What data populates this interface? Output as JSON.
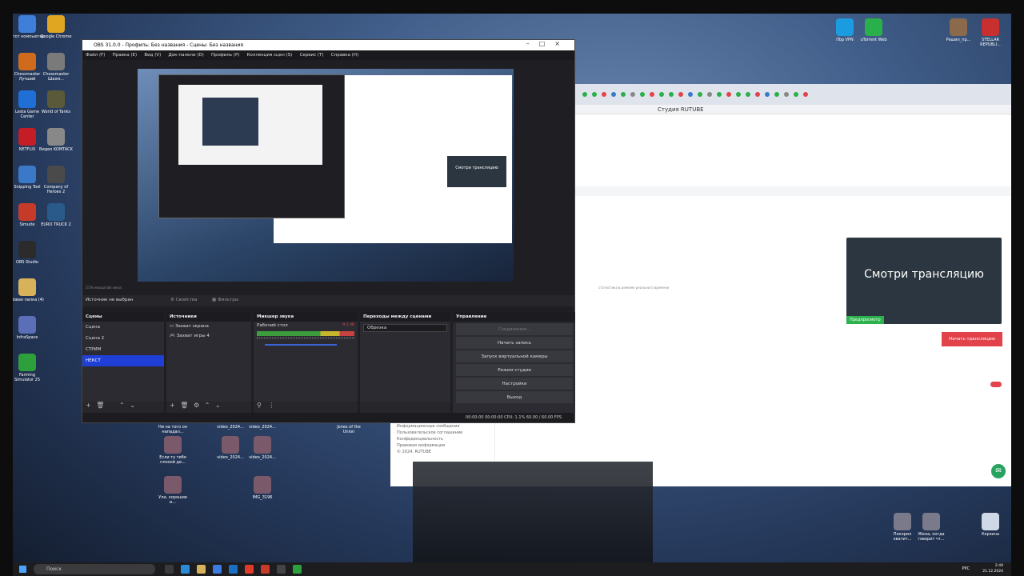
{
  "desktop": {
    "icons_left": [
      {
        "label": "Этот компьютер",
        "color": "#3f7fd9"
      },
      {
        "label": "Google Chrome",
        "color": "#e0a521"
      },
      {
        "label": "Chessmaster Лучший",
        "color": "#d06a1c"
      },
      {
        "label": "Chessmaster Шахм...",
        "color": "#7a7a7a"
      },
      {
        "label": "Lesta Game Center",
        "color": "#1f6fd6"
      },
      {
        "label": "World of Tanks",
        "color": "#5a5a3a"
      },
      {
        "label": "NETFLIX",
        "color": "#c41d25"
      },
      {
        "label": "Видео KOMTACK",
        "color": "#888888"
      },
      {
        "label": "Snipping Tool",
        "color": "#3a78c8"
      },
      {
        "label": "Company of Heroes 2",
        "color": "#4a4a4a"
      },
      {
        "label": "Simuite",
        "color": "#c63a2a"
      },
      {
        "label": "EURO TRUCK 2",
        "color": "#2a5a8a"
      },
      {
        "label": "OBS Studio",
        "color": "#2b2b2b"
      },
      {
        "label": "Новая папка (4)",
        "color": "#d8b25a"
      },
      {
        "label": "InfraSpace",
        "color": "#5a6fb8"
      },
      {
        "label": "Farming Simulator 25",
        "color": "#2e9f3d"
      }
    ],
    "icons_mid": [
      {
        "label": "Ни на того он нападал..."
      },
      {
        "label": "video_2024..."
      },
      {
        "label": "video_2024..."
      },
      {
        "label": "Jones of the Union"
      },
      {
        "label": "Если ту тебя плохой де..."
      },
      {
        "label": "video_2024..."
      },
      {
        "label": "video_2024..."
      },
      {
        "label": "Ули, хорошие и..."
      },
      {
        "label": "IMG_3196"
      }
    ],
    "icons_right_top": [
      {
        "label": "iTop VPN"
      },
      {
        "label": "uTorrent Web"
      },
      {
        "label": "Решил_пр..."
      },
      {
        "label": "STELLAR REPUBLI..."
      }
    ],
    "icons_right_bottom": [
      {
        "label": "Покорил хватит..."
      },
      {
        "label": "Жена, когда говорит чт..."
      },
      {
        "label": "Корзина"
      }
    ]
  },
  "browser": {
    "title": "Студия RUTUBE",
    "preview_title": "Смотри трансляцию",
    "preview_badge": "Предпросмотр",
    "start_stream_button": "Начать трансляцию",
    "faint_note": "статистика в режиме реального времени",
    "footer": [
      "Информационные сообщения",
      "Пользовательское соглашение",
      "Конфиденциальность",
      "Правовая информация",
      "© 2024, RUTUBE"
    ],
    "chat_icon": "chat-icon",
    "accent": "#e2434b"
  },
  "obs": {
    "title": "OBS 31.0.0 - Профиль: Без названия - Сцены: Без названия",
    "menu": [
      "Файл (F)",
      "Правка (E)",
      "Вид (V)",
      "Док-панели (D)",
      "Профиль (P)",
      "Коллекция сцен (S)",
      "Сервис (T)",
      "Справка (H)"
    ],
    "inner_card_text": "Смотри трансляцию",
    "zoom_note": "51%  масштаб окна",
    "no_source": "Источник не выбран",
    "properties": "Свойства",
    "filters": "Фильтры",
    "docks": {
      "scenes": {
        "title": "Сцены",
        "items": [
          "Сцена",
          "Сцена 2",
          "СТРИМ",
          "НЕКСТ"
        ],
        "active": "НЕКСТ"
      },
      "sources": {
        "title": "Источники",
        "items": [
          "Захват экрана",
          "Захват игры 4"
        ]
      },
      "mixer": {
        "title": "Микшер звука",
        "channel": "Рабочий стол",
        "db": "-9.2 dB"
      },
      "transitions": {
        "title": "Переходы между сценами",
        "selected": "Обрезка"
      },
      "controls": {
        "title": "Управление",
        "buttons": [
          "Соединение...",
          "Начать запись",
          "Запуск виртуальной камеры",
          "Режим студии",
          "Настройки",
          "Выход"
        ]
      }
    },
    "status": "00:00:00    00:00:00    CPU: 1.1%    60.00 / 60.00 FPS"
  },
  "taskbar": {
    "search_placeholder": "Поиск",
    "lang": "РУС",
    "time": "2:49",
    "date": "21.12.2024"
  }
}
